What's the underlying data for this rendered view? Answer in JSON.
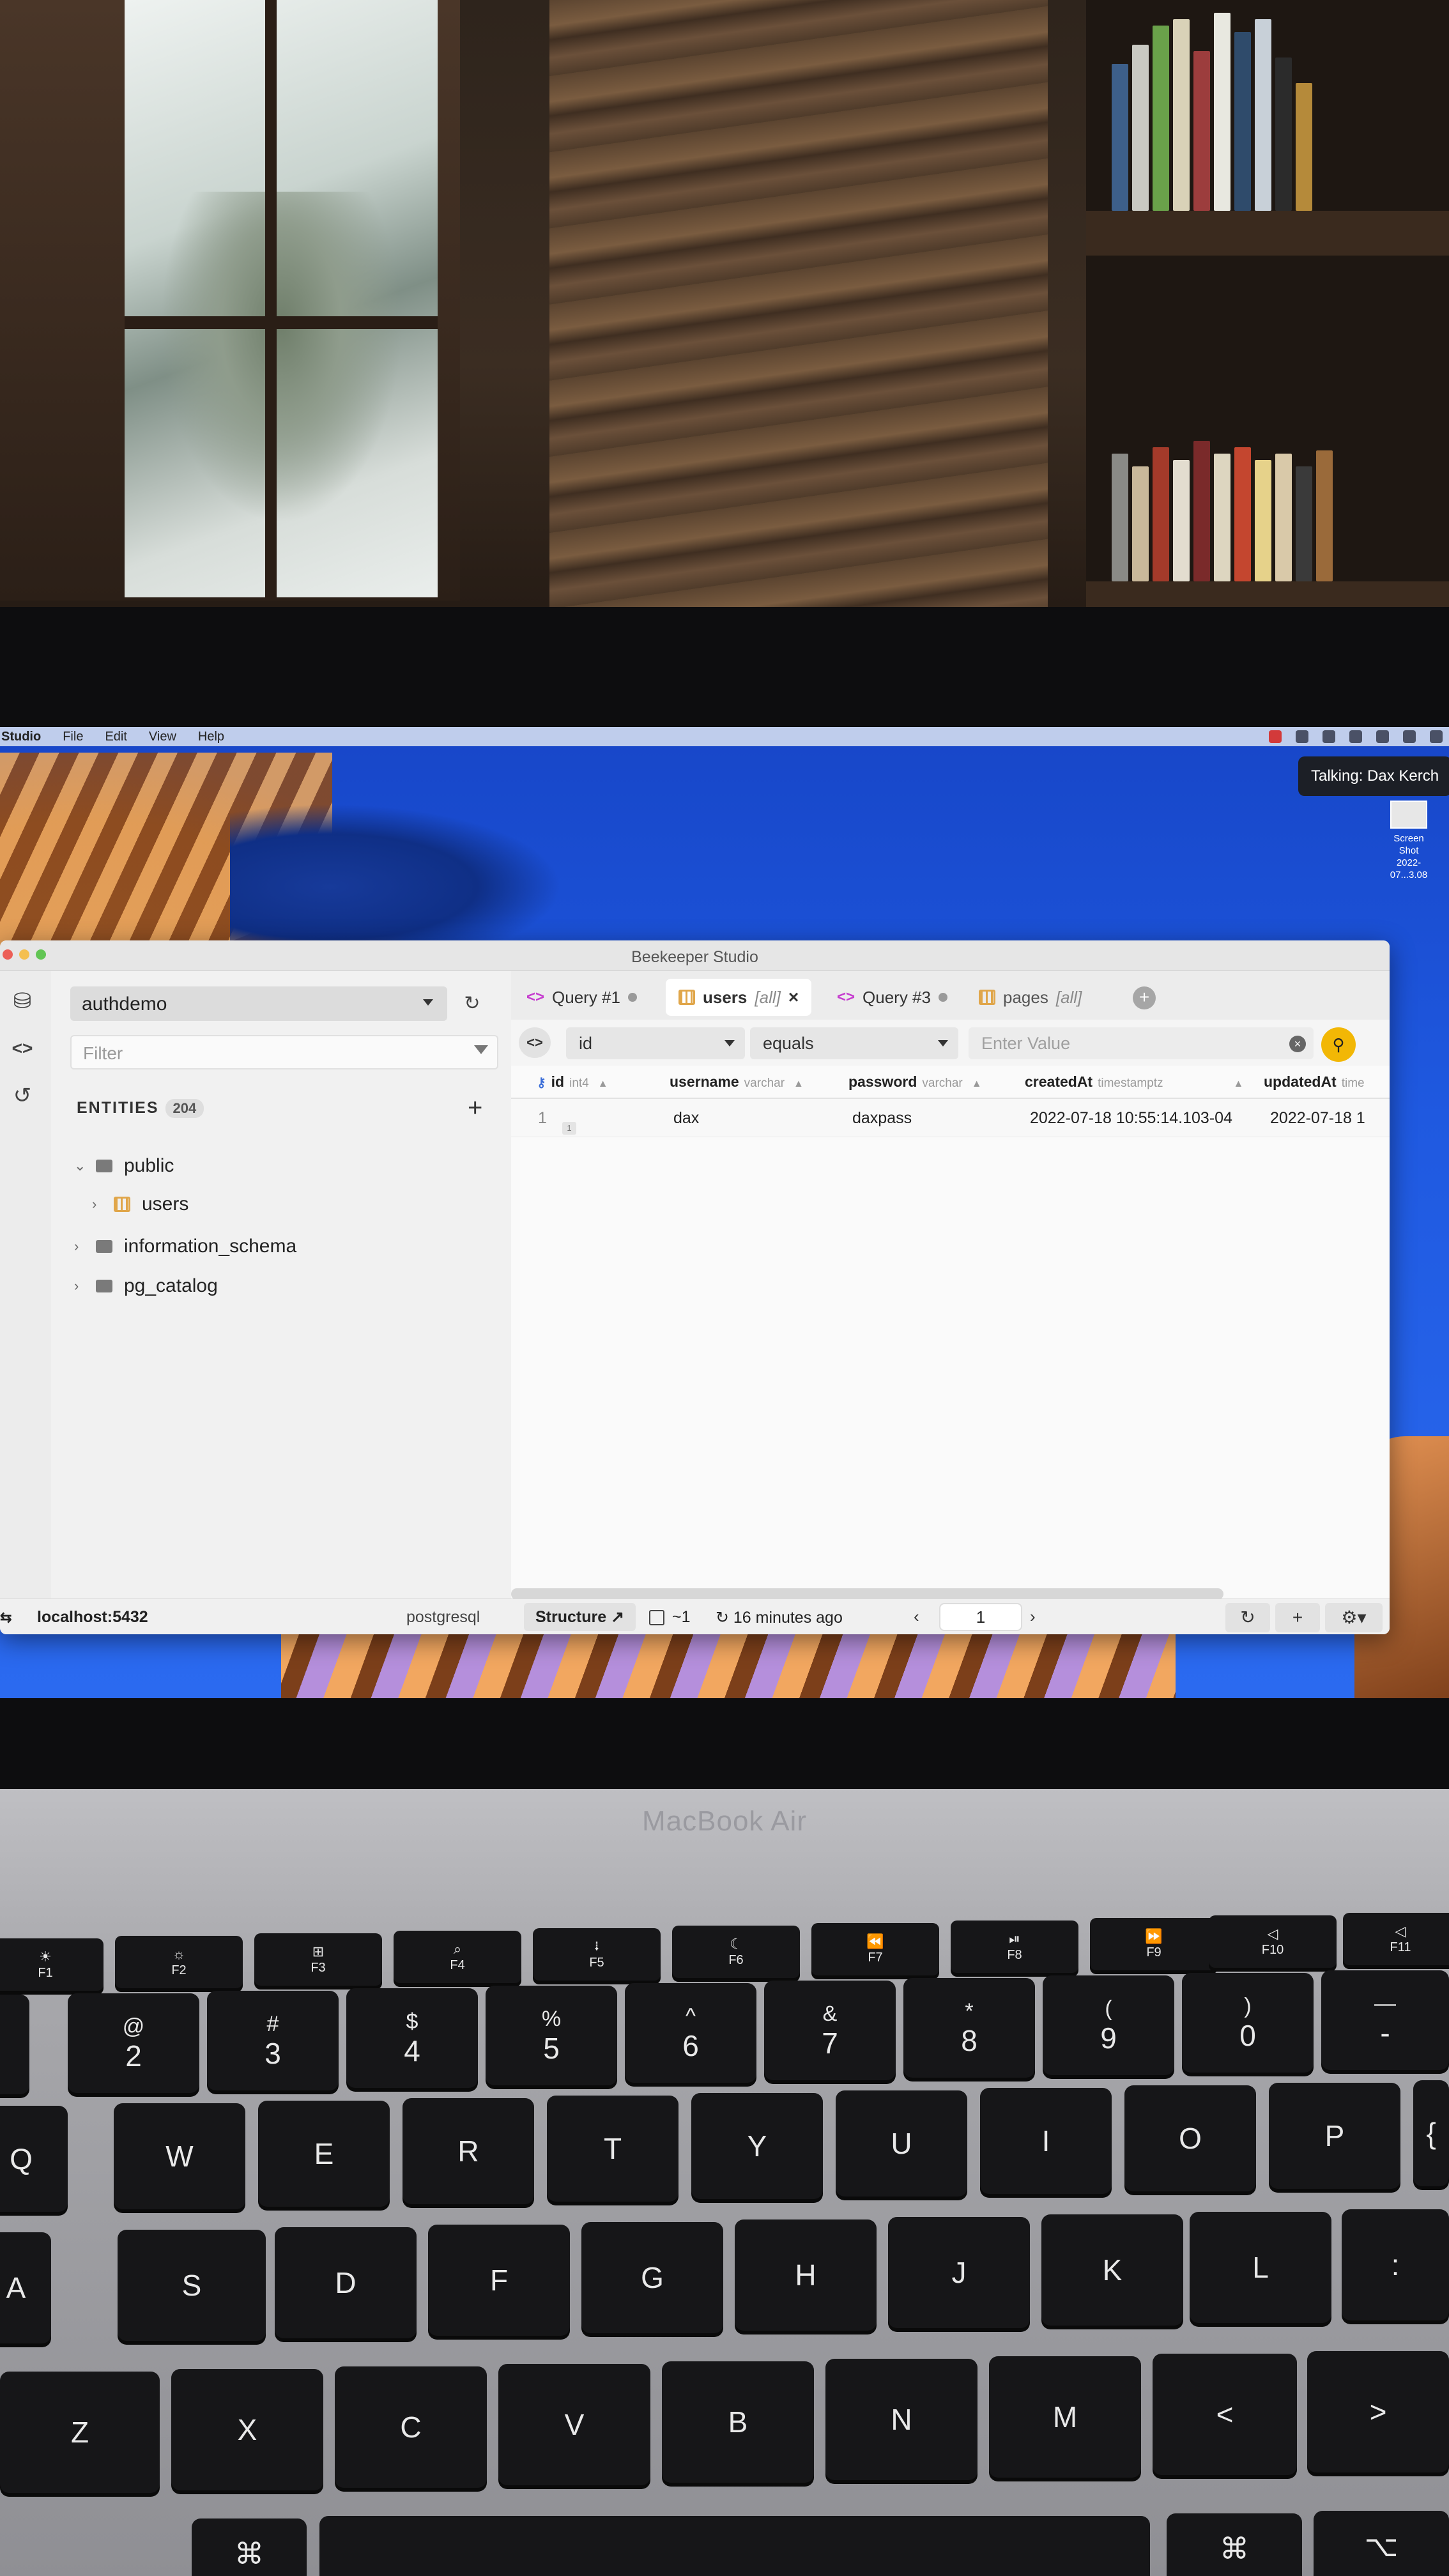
{
  "menubar": {
    "items": [
      "Studio",
      "File",
      "Edit",
      "View",
      "Help"
    ]
  },
  "notification": {
    "talking": "Talking: Dax Kerch"
  },
  "desktop_file": {
    "line1": "Screen Shot",
    "line2": "2022-07...3.08"
  },
  "window": {
    "title": "Beekeeper Studio"
  },
  "sidebar": {
    "connection": "authdemo",
    "filter_placeholder": "Filter",
    "entities_label": "ENTITIES",
    "entities_count": "204",
    "tree": [
      {
        "label": "public",
        "expanded": true
      },
      {
        "label": "users",
        "child": true
      },
      {
        "label": "information_schema",
        "expanded": false
      },
      {
        "label": "pg_catalog",
        "expanded": false
      }
    ]
  },
  "tabs": [
    {
      "label": "Query #1",
      "kind": "query",
      "active": false
    },
    {
      "label": "users",
      "sub": "[all]",
      "kind": "table",
      "active": true
    },
    {
      "label": "Query #3",
      "kind": "query",
      "active": false
    },
    {
      "label": "pages",
      "sub": "[all]",
      "kind": "table",
      "active": false
    }
  ],
  "filter": {
    "column": "id",
    "operator": "equals",
    "value_placeholder": "Enter Value"
  },
  "columns": [
    {
      "name": "id",
      "type": "int4"
    },
    {
      "name": "username",
      "type": "varchar"
    },
    {
      "name": "password",
      "type": "varchar"
    },
    {
      "name": "createdAt",
      "type": "timestamptz"
    },
    {
      "name": "updatedAt",
      "type": "time"
    }
  ],
  "rows": [
    {
      "id": "1",
      "id_badge": "1",
      "username": "dax",
      "password": "daxpass",
      "createdAt": "2022-07-18 10:55:14.103-04",
      "updatedAt": "2022-07-18 1"
    }
  ],
  "statusbar": {
    "host": "localhost:5432",
    "dialect": "postgresql",
    "structure_label": "Structure ↗",
    "row_count": "~1",
    "updated": "16 minutes ago",
    "page": "1"
  },
  "laptop": {
    "brand": "MacBook Air"
  },
  "keyboard": {
    "fn_row": [
      {
        "label": "F1",
        "glyph": "☀"
      },
      {
        "label": "F2",
        "glyph": "☼"
      },
      {
        "label": "F3",
        "glyph": "⊞"
      },
      {
        "label": "F4",
        "glyph": "⌕"
      },
      {
        "label": "F5",
        "glyph": "⭭"
      },
      {
        "label": "F6",
        "glyph": "☾"
      },
      {
        "label": "F7",
        "glyph": "⏪"
      },
      {
        "label": "F8",
        "glyph": "⏯"
      },
      {
        "label": "F9",
        "glyph": "⏩"
      },
      {
        "label": "F10",
        "glyph": "◁"
      },
      {
        "label": "F11",
        "glyph": "◁"
      }
    ],
    "number_row": [
      {
        "top": "!",
        "main": ""
      },
      {
        "top": "@",
        "main": "2"
      },
      {
        "top": "#",
        "main": "3"
      },
      {
        "top": "$",
        "main": "4"
      },
      {
        "top": "%",
        "main": "5"
      },
      {
        "top": "^",
        "main": "6"
      },
      {
        "top": "&",
        "main": "7"
      },
      {
        "top": "*",
        "main": "8"
      },
      {
        "top": "(",
        "main": "9"
      },
      {
        "top": ")",
        "main": "0"
      },
      {
        "top": "—",
        "main": "-"
      }
    ],
    "row_q": [
      "Q",
      "W",
      "E",
      "R",
      "T",
      "Y",
      "U",
      "I",
      "O",
      "P",
      "{"
    ],
    "row_a": [
      "A",
      "S",
      "D",
      "F",
      "G",
      "H",
      "J",
      "K",
      "L",
      ":"
    ],
    "row_z": [
      "Z",
      "X",
      "C",
      "V",
      "B",
      "N",
      "M",
      "<",
      ">"
    ],
    "bottom": [
      "⌘",
      "⌥"
    ]
  }
}
